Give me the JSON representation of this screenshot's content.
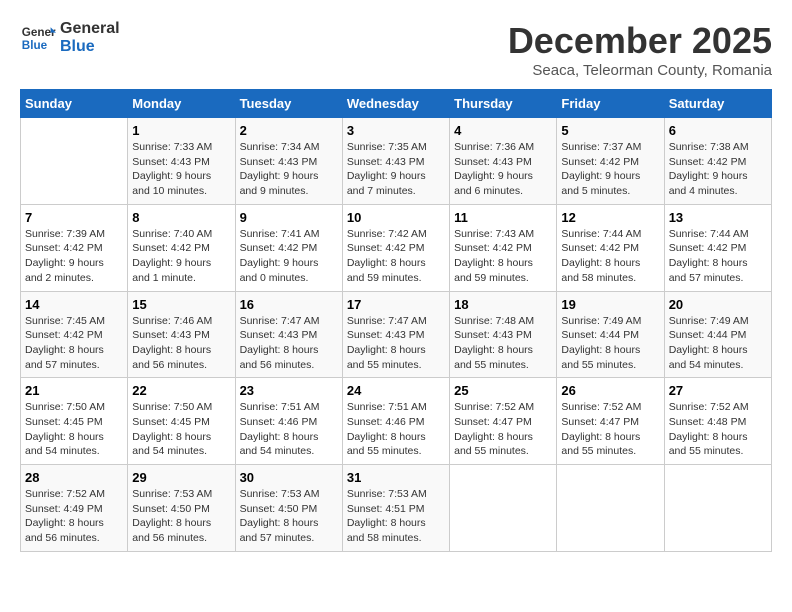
{
  "header": {
    "logo_line1": "General",
    "logo_line2": "Blue",
    "month": "December 2025",
    "location": "Seaca, Teleorman County, Romania"
  },
  "days_of_week": [
    "Sunday",
    "Monday",
    "Tuesday",
    "Wednesday",
    "Thursday",
    "Friday",
    "Saturday"
  ],
  "weeks": [
    [
      {
        "day": "",
        "info": ""
      },
      {
        "day": "1",
        "info": "Sunrise: 7:33 AM\nSunset: 4:43 PM\nDaylight: 9 hours\nand 10 minutes."
      },
      {
        "day": "2",
        "info": "Sunrise: 7:34 AM\nSunset: 4:43 PM\nDaylight: 9 hours\nand 9 minutes."
      },
      {
        "day": "3",
        "info": "Sunrise: 7:35 AM\nSunset: 4:43 PM\nDaylight: 9 hours\nand 7 minutes."
      },
      {
        "day": "4",
        "info": "Sunrise: 7:36 AM\nSunset: 4:43 PM\nDaylight: 9 hours\nand 6 minutes."
      },
      {
        "day": "5",
        "info": "Sunrise: 7:37 AM\nSunset: 4:42 PM\nDaylight: 9 hours\nand 5 minutes."
      },
      {
        "day": "6",
        "info": "Sunrise: 7:38 AM\nSunset: 4:42 PM\nDaylight: 9 hours\nand 4 minutes."
      }
    ],
    [
      {
        "day": "7",
        "info": "Sunrise: 7:39 AM\nSunset: 4:42 PM\nDaylight: 9 hours\nand 2 minutes."
      },
      {
        "day": "8",
        "info": "Sunrise: 7:40 AM\nSunset: 4:42 PM\nDaylight: 9 hours\nand 1 minute."
      },
      {
        "day": "9",
        "info": "Sunrise: 7:41 AM\nSunset: 4:42 PM\nDaylight: 9 hours\nand 0 minutes."
      },
      {
        "day": "10",
        "info": "Sunrise: 7:42 AM\nSunset: 4:42 PM\nDaylight: 8 hours\nand 59 minutes."
      },
      {
        "day": "11",
        "info": "Sunrise: 7:43 AM\nSunset: 4:42 PM\nDaylight: 8 hours\nand 59 minutes."
      },
      {
        "day": "12",
        "info": "Sunrise: 7:44 AM\nSunset: 4:42 PM\nDaylight: 8 hours\nand 58 minutes."
      },
      {
        "day": "13",
        "info": "Sunrise: 7:44 AM\nSunset: 4:42 PM\nDaylight: 8 hours\nand 57 minutes."
      }
    ],
    [
      {
        "day": "14",
        "info": "Sunrise: 7:45 AM\nSunset: 4:42 PM\nDaylight: 8 hours\nand 57 minutes."
      },
      {
        "day": "15",
        "info": "Sunrise: 7:46 AM\nSunset: 4:43 PM\nDaylight: 8 hours\nand 56 minutes."
      },
      {
        "day": "16",
        "info": "Sunrise: 7:47 AM\nSunset: 4:43 PM\nDaylight: 8 hours\nand 56 minutes."
      },
      {
        "day": "17",
        "info": "Sunrise: 7:47 AM\nSunset: 4:43 PM\nDaylight: 8 hours\nand 55 minutes."
      },
      {
        "day": "18",
        "info": "Sunrise: 7:48 AM\nSunset: 4:43 PM\nDaylight: 8 hours\nand 55 minutes."
      },
      {
        "day": "19",
        "info": "Sunrise: 7:49 AM\nSunset: 4:44 PM\nDaylight: 8 hours\nand 55 minutes."
      },
      {
        "day": "20",
        "info": "Sunrise: 7:49 AM\nSunset: 4:44 PM\nDaylight: 8 hours\nand 54 minutes."
      }
    ],
    [
      {
        "day": "21",
        "info": "Sunrise: 7:50 AM\nSunset: 4:45 PM\nDaylight: 8 hours\nand 54 minutes."
      },
      {
        "day": "22",
        "info": "Sunrise: 7:50 AM\nSunset: 4:45 PM\nDaylight: 8 hours\nand 54 minutes."
      },
      {
        "day": "23",
        "info": "Sunrise: 7:51 AM\nSunset: 4:46 PM\nDaylight: 8 hours\nand 54 minutes."
      },
      {
        "day": "24",
        "info": "Sunrise: 7:51 AM\nSunset: 4:46 PM\nDaylight: 8 hours\nand 55 minutes."
      },
      {
        "day": "25",
        "info": "Sunrise: 7:52 AM\nSunset: 4:47 PM\nDaylight: 8 hours\nand 55 minutes."
      },
      {
        "day": "26",
        "info": "Sunrise: 7:52 AM\nSunset: 4:47 PM\nDaylight: 8 hours\nand 55 minutes."
      },
      {
        "day": "27",
        "info": "Sunrise: 7:52 AM\nSunset: 4:48 PM\nDaylight: 8 hours\nand 55 minutes."
      }
    ],
    [
      {
        "day": "28",
        "info": "Sunrise: 7:52 AM\nSunset: 4:49 PM\nDaylight: 8 hours\nand 56 minutes."
      },
      {
        "day": "29",
        "info": "Sunrise: 7:53 AM\nSunset: 4:50 PM\nDaylight: 8 hours\nand 56 minutes."
      },
      {
        "day": "30",
        "info": "Sunrise: 7:53 AM\nSunset: 4:50 PM\nDaylight: 8 hours\nand 57 minutes."
      },
      {
        "day": "31",
        "info": "Sunrise: 7:53 AM\nSunset: 4:51 PM\nDaylight: 8 hours\nand 58 minutes."
      },
      {
        "day": "",
        "info": ""
      },
      {
        "day": "",
        "info": ""
      },
      {
        "day": "",
        "info": ""
      }
    ]
  ]
}
